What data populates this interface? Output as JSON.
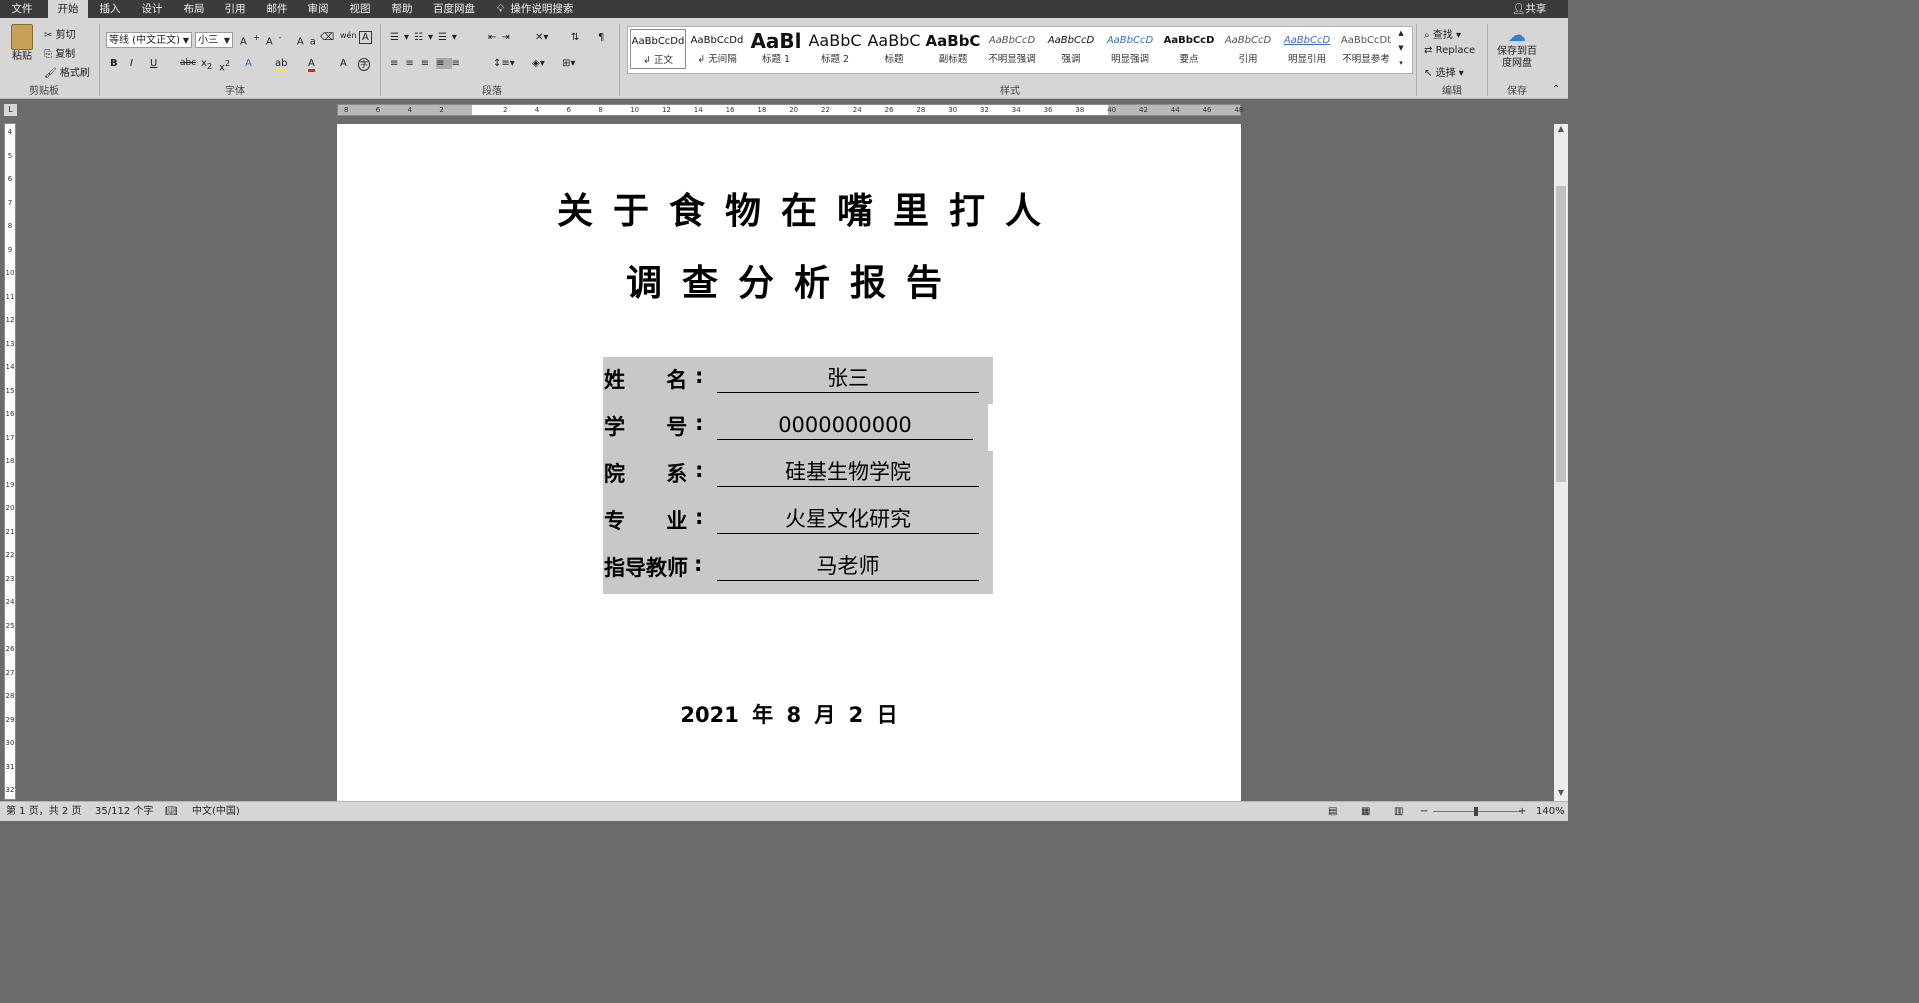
{
  "menu": {
    "tabs": [
      "文件",
      "开始",
      "插入",
      "设计",
      "布局",
      "引用",
      "邮件",
      "审阅",
      "视图",
      "帮助",
      "百度网盘"
    ],
    "active": "开始",
    "tell_me": "操作说明搜索",
    "share": "共享"
  },
  "ribbon": {
    "clipboard": {
      "paste": "粘贴",
      "cut": "剪切",
      "copy": "复制",
      "format_painter": "格式刷",
      "label": "剪贴板"
    },
    "font": {
      "name": "等线 (中文正文)",
      "size": "小三",
      "label": "字体"
    },
    "paragraph": {
      "label": "段落"
    },
    "styles": {
      "label": "样式",
      "items": [
        {
          "preview": "AaBbCcDd",
          "name": "↲ 正文"
        },
        {
          "preview": "AaBbCcDd",
          "name": "↲ 无间隔"
        },
        {
          "preview": "AaBl",
          "name": "标题 1"
        },
        {
          "preview": "AaBbC",
          "name": "标题 2"
        },
        {
          "preview": "AaBbC",
          "name": "标题"
        },
        {
          "preview": "AaBbC",
          "name": "副标题"
        },
        {
          "preview": "AaBbCcD",
          "name": "不明显强调"
        },
        {
          "preview": "AaBbCcD",
          "name": "强调"
        },
        {
          "preview": "AaBbCcD",
          "name": "明显强调"
        },
        {
          "preview": "AaBbCcD",
          "name": "要点"
        },
        {
          "preview": "AaBbCcD",
          "name": "引用"
        },
        {
          "preview": "AaBbCcD",
          "name": "明显引用"
        },
        {
          "preview": "AaBbCcDt",
          "name": "不明显参考"
        }
      ]
    },
    "editing": {
      "find": "查找",
      "replace": "Replace",
      "select": "选择",
      "label": "编辑"
    },
    "save": {
      "button": "保存到百度网盘",
      "label": "保存"
    }
  },
  "document": {
    "title_line1": "关于食物在嘴里打人",
    "title_line2": "调查分析报告",
    "fields": [
      {
        "label": "姓 名",
        "value": "张三"
      },
      {
        "label": "学 号",
        "value": "0000000000"
      },
      {
        "label": "院 系",
        "value": "硅基生物学院"
      },
      {
        "label": "专 业",
        "value": "火星文化研究"
      },
      {
        "label": "指导教师",
        "value": "马老师"
      }
    ],
    "date": "2021 年  8 月 2 日"
  },
  "status": {
    "page": "第 1 页，共 2 页",
    "words": "35/112 个字",
    "language": "中文(中国)",
    "zoom": "140%"
  }
}
